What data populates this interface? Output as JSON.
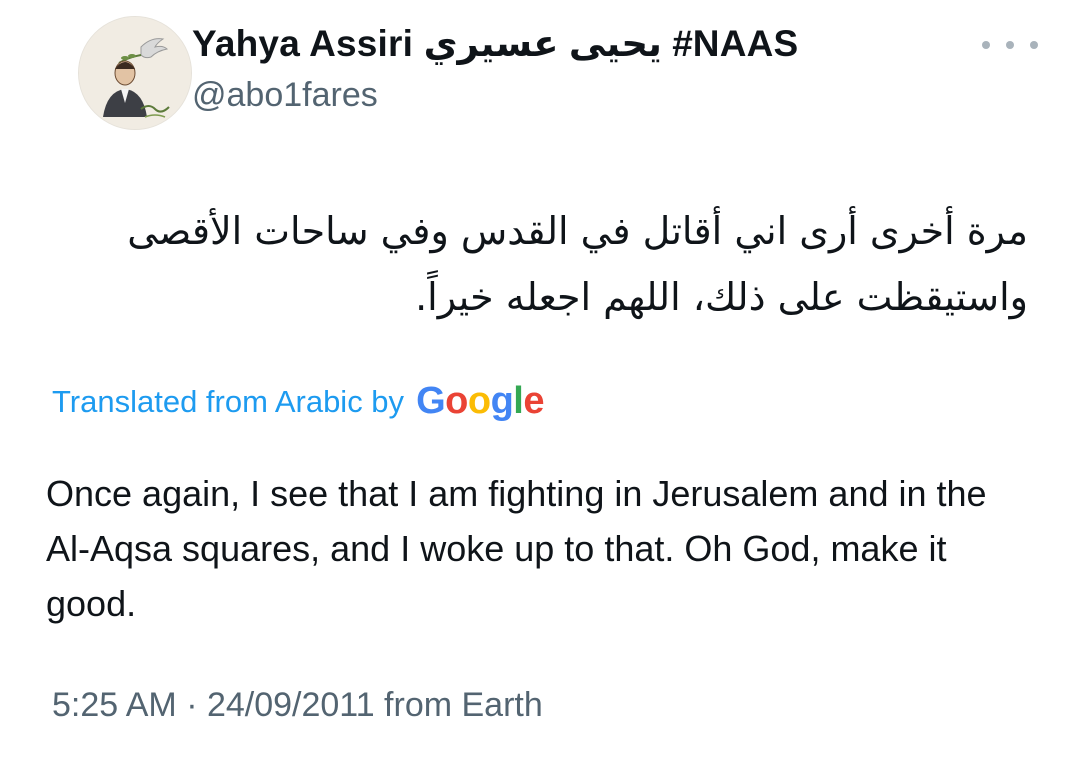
{
  "author": {
    "display_name": "Yahya Assiri يحيى عسيري #NAAS",
    "handle": "@abo1fares"
  },
  "tweet": {
    "text_ar": "مرة أخرى أرى اني أقاتل في القدس وفي ساحات الأقصى واستيقظت على ذلك، اللهم اجعله خيراً.",
    "translation_label": "Translated from Arabic by",
    "translation_provider": [
      "G",
      "o",
      "o",
      "g",
      "l",
      "e"
    ],
    "text_en": "Once again, I see that I am fighting in Jerusalem and in the Al-Aqsa squares, and I woke up to that. Oh God, make it good.",
    "timestamp": "5:25 AM · 24/09/2011 from Earth"
  },
  "icons": {
    "more": "more-horizontal-icon",
    "avatar": "profile-avatar-illustration"
  },
  "colors": {
    "link_blue": "#1d9bf0",
    "secondary_text": "#536471",
    "primary_text": "#0f1419",
    "google": [
      "#4285F4",
      "#EA4335",
      "#FBBC05",
      "#4285F4",
      "#34A853",
      "#EA4335"
    ]
  }
}
